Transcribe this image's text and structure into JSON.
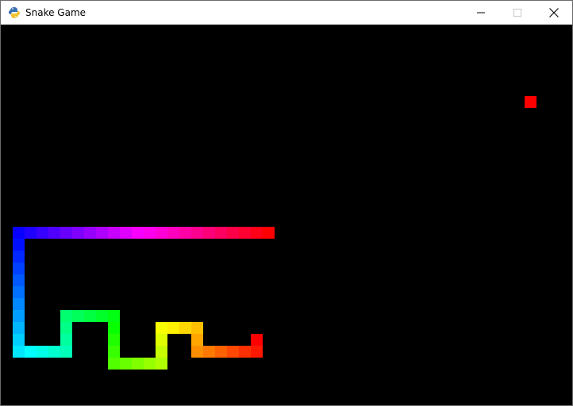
{
  "window": {
    "title": "Snake Game",
    "app_icon": "python-snake-icon",
    "controls": [
      "minimize-icon",
      "maximize-icon",
      "close-icon"
    ]
  },
  "game": {
    "grid_cell": 15,
    "food": {
      "col": 44,
      "row": 6,
      "color": "#ff0000"
    },
    "snake": [
      [
        22,
        17
      ],
      [
        21,
        17
      ],
      [
        20,
        17
      ],
      [
        19,
        17
      ],
      [
        18,
        17
      ],
      [
        17,
        17
      ],
      [
        16,
        17
      ],
      [
        15,
        17
      ],
      [
        14,
        17
      ],
      [
        13,
        17
      ],
      [
        12,
        17
      ],
      [
        11,
        17
      ],
      [
        10,
        17
      ],
      [
        9,
        17
      ],
      [
        8,
        17
      ],
      [
        7,
        17
      ],
      [
        6,
        17
      ],
      [
        5,
        17
      ],
      [
        4,
        17
      ],
      [
        3,
        17
      ],
      [
        2,
        17
      ],
      [
        1,
        17
      ],
      [
        1,
        18
      ],
      [
        1,
        19
      ],
      [
        1,
        20
      ],
      [
        1,
        21
      ],
      [
        1,
        22
      ],
      [
        1,
        23
      ],
      [
        1,
        24
      ],
      [
        1,
        25
      ],
      [
        1,
        26
      ],
      [
        1,
        27
      ],
      [
        2,
        27
      ],
      [
        3,
        27
      ],
      [
        4,
        27
      ],
      [
        5,
        27
      ],
      [
        5,
        26
      ],
      [
        5,
        25
      ],
      [
        5,
        24
      ],
      [
        6,
        24
      ],
      [
        7,
        24
      ],
      [
        8,
        24
      ],
      [
        9,
        24
      ],
      [
        9,
        25
      ],
      [
        9,
        26
      ],
      [
        9,
        27
      ],
      [
        9,
        28
      ],
      [
        10,
        28
      ],
      [
        11,
        28
      ],
      [
        12,
        28
      ],
      [
        13,
        28
      ],
      [
        13,
        27
      ],
      [
        13,
        26
      ],
      [
        13,
        25
      ],
      [
        14,
        25
      ],
      [
        15,
        25
      ],
      [
        16,
        25
      ],
      [
        16,
        26
      ],
      [
        16,
        27
      ],
      [
        17,
        27
      ],
      [
        18,
        27
      ],
      [
        19,
        27
      ],
      [
        20,
        27
      ],
      [
        21,
        27
      ],
      [
        21,
        26
      ]
    ]
  }
}
